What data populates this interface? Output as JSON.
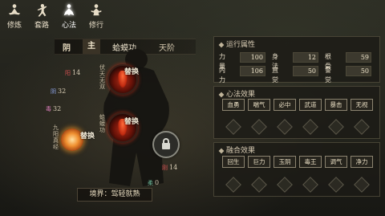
{
  "nav": {
    "items": [
      {
        "label": "修炼",
        "icon": "meditation-icon",
        "active": false
      },
      {
        "label": "套路",
        "icon": "martial-stance-icon",
        "active": false
      },
      {
        "label": "心法",
        "icon": "heart-method-icon",
        "active": true
      },
      {
        "label": "修行",
        "icon": "cultivation-icon",
        "active": false
      }
    ]
  },
  "art": {
    "yin_label": "阴",
    "main_label": "主",
    "name": "蛤蟆功",
    "rank": "天阶"
  },
  "figure": {
    "swap_label": "替换",
    "node_top_text": "伏天无双",
    "node_mid_text": "蛤蟆功",
    "node_left_text": "九阳真经",
    "stats": [
      {
        "glyph": "阳",
        "value": "14"
      },
      {
        "glyph": "阴",
        "value": "32"
      },
      {
        "glyph": "毒",
        "value": "32"
      },
      {
        "glyph": "刚",
        "value": "14"
      },
      {
        "glyph": "柔",
        "value": "0"
      }
    ],
    "realm": "境界：驾轻就熟"
  },
  "attributes": {
    "title": "运行属性",
    "rows": [
      [
        {
          "label": "力量",
          "value": "100"
        },
        {
          "label": "身法",
          "value": "12"
        },
        {
          "label": "根骨",
          "value": "59"
        }
      ],
      [
        {
          "label": "内力",
          "value": "106"
        },
        {
          "label": "直觉",
          "value": "50"
        },
        {
          "label": "警觉",
          "value": "50"
        }
      ]
    ]
  },
  "heart_effects": {
    "title": "心法效果",
    "effects": [
      "血勇",
      "喘气",
      "必中",
      "武道",
      "暴击",
      "无视"
    ]
  },
  "fusion_effects": {
    "title": "融合效果",
    "effects": [
      "回生",
      "巨力",
      "玉阴",
      "毒王",
      "调气",
      "净力"
    ]
  }
}
